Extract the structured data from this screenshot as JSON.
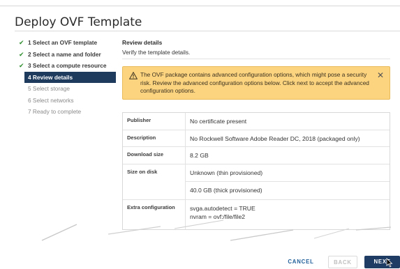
{
  "dialog": {
    "title": "Deploy OVF Template"
  },
  "steps": [
    {
      "label": "1 Select an OVF template",
      "status": "done"
    },
    {
      "label": "2 Select a name and folder",
      "status": "done"
    },
    {
      "label": "3 Select a compute resource",
      "status": "done"
    },
    {
      "label": "4 Review details",
      "status": "active"
    },
    {
      "label": "5 Select storage",
      "status": "todo"
    },
    {
      "label": "6 Select networks",
      "status": "todo"
    },
    {
      "label": "7 Ready to complete",
      "status": "todo"
    }
  ],
  "review": {
    "title": "Review details",
    "subtitle": "Verify the template details."
  },
  "warning": {
    "text": "The OVF package contains advanced configuration options, which might pose a security risk. Review the advanced configuration options below. Click next to accept the advanced configuration options.",
    "close": "✕"
  },
  "details": {
    "publisher_label": "Publisher",
    "publisher_value": "No certificate present",
    "description_label": "Description",
    "description_value": "No Rockwell Software Adobe Reader DC, 2018 (packaged only)",
    "download_label": "Download size",
    "download_value": "8.2 GB",
    "disk_label": "Size on disk",
    "disk_thin": "Unknown (thin provisioned)",
    "disk_thick": "40.0 GB (thick provisioned)",
    "extra_label": "Extra configuration",
    "extra_line1": "svga.autodetect = TRUE",
    "extra_line2": "nvram = ovf:/file/file2"
  },
  "footer": {
    "cancel": "CANCEL",
    "back": "BACK",
    "next": "NEXT"
  },
  "colors": {
    "accent": "#1e3b5e",
    "warning_bg": "#fcd47f",
    "check": "#2f8e2f",
    "link": "#1f5f99"
  }
}
